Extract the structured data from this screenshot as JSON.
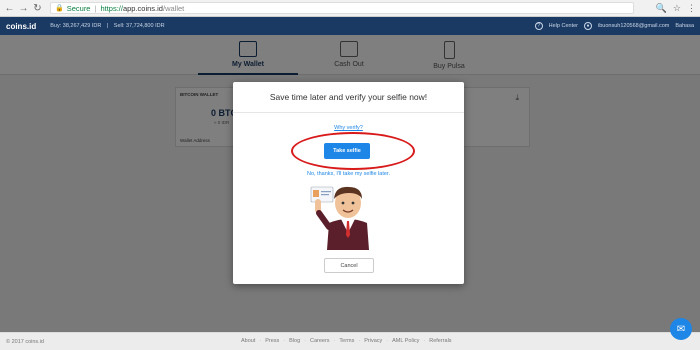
{
  "browser": {
    "secure_label": "Secure",
    "url_scheme": "https://",
    "url_host": "app.coins.id",
    "url_path": "/wallet"
  },
  "header": {
    "logo": "coins.id",
    "buy_price": "Buy: 38,267,429 IDR",
    "sell_price": "Sell: 37,724,800 IDR",
    "help_label": "Help Center",
    "user_email": "ibuonsuh120568@gmail.com",
    "language": "Bahasa"
  },
  "tabs": [
    {
      "label": "My Wallet",
      "active": true
    },
    {
      "label": "Cash Out",
      "active": false
    },
    {
      "label": "Buy Pulsa",
      "active": false
    }
  ],
  "wallet_card": {
    "title": "BITCOIN WALLET",
    "btc_balance": "0 BTC",
    "idr_balance": "≈ 0 IDR",
    "address_label": "Wallet Address"
  },
  "modal": {
    "title": "Save time later and verify your selfie now!",
    "why_link": "Why verify?",
    "take_selfie_label": "Take selfie",
    "later_link": "No, thanks, I'll take my selfie later.",
    "cancel_label": "Cancel"
  },
  "footer": {
    "copyright": "© 2017 coins.id",
    "links": [
      "About",
      "Press",
      "Blog",
      "Careers",
      "Terms",
      "Privacy",
      "AML Policy",
      "Referrals"
    ]
  },
  "colors": {
    "header_bg": "#1b3a63",
    "primary_button": "#1e86e6",
    "highlight_ellipse": "#d81a1a",
    "chat_bubble": "#1e86e6"
  }
}
